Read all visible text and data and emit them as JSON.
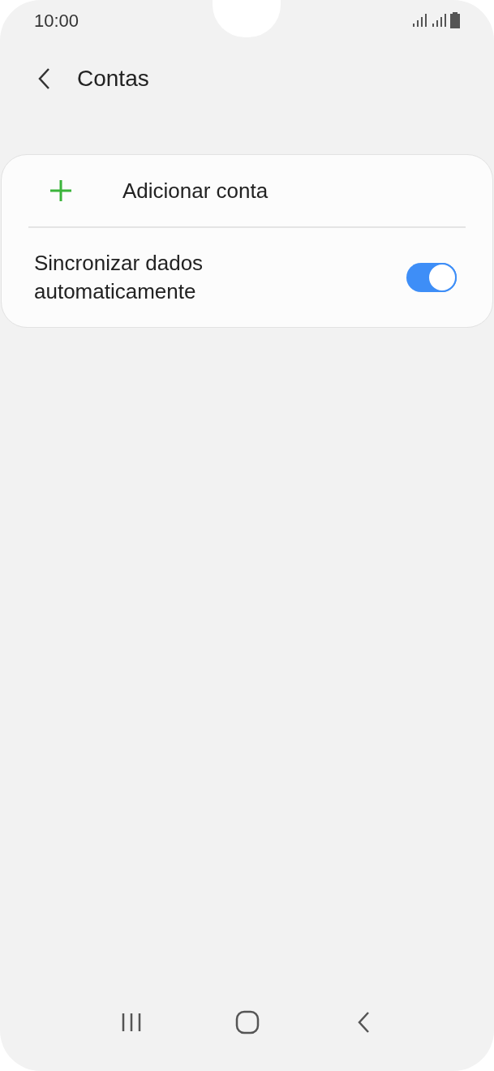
{
  "status_bar": {
    "time": "10:00"
  },
  "header": {
    "title": "Contas"
  },
  "items": [
    {
      "kind": "action",
      "label": "Adicionar conta"
    },
    {
      "kind": "toggle",
      "label": "Sincronizar dados automaticamente",
      "on": true
    }
  ]
}
